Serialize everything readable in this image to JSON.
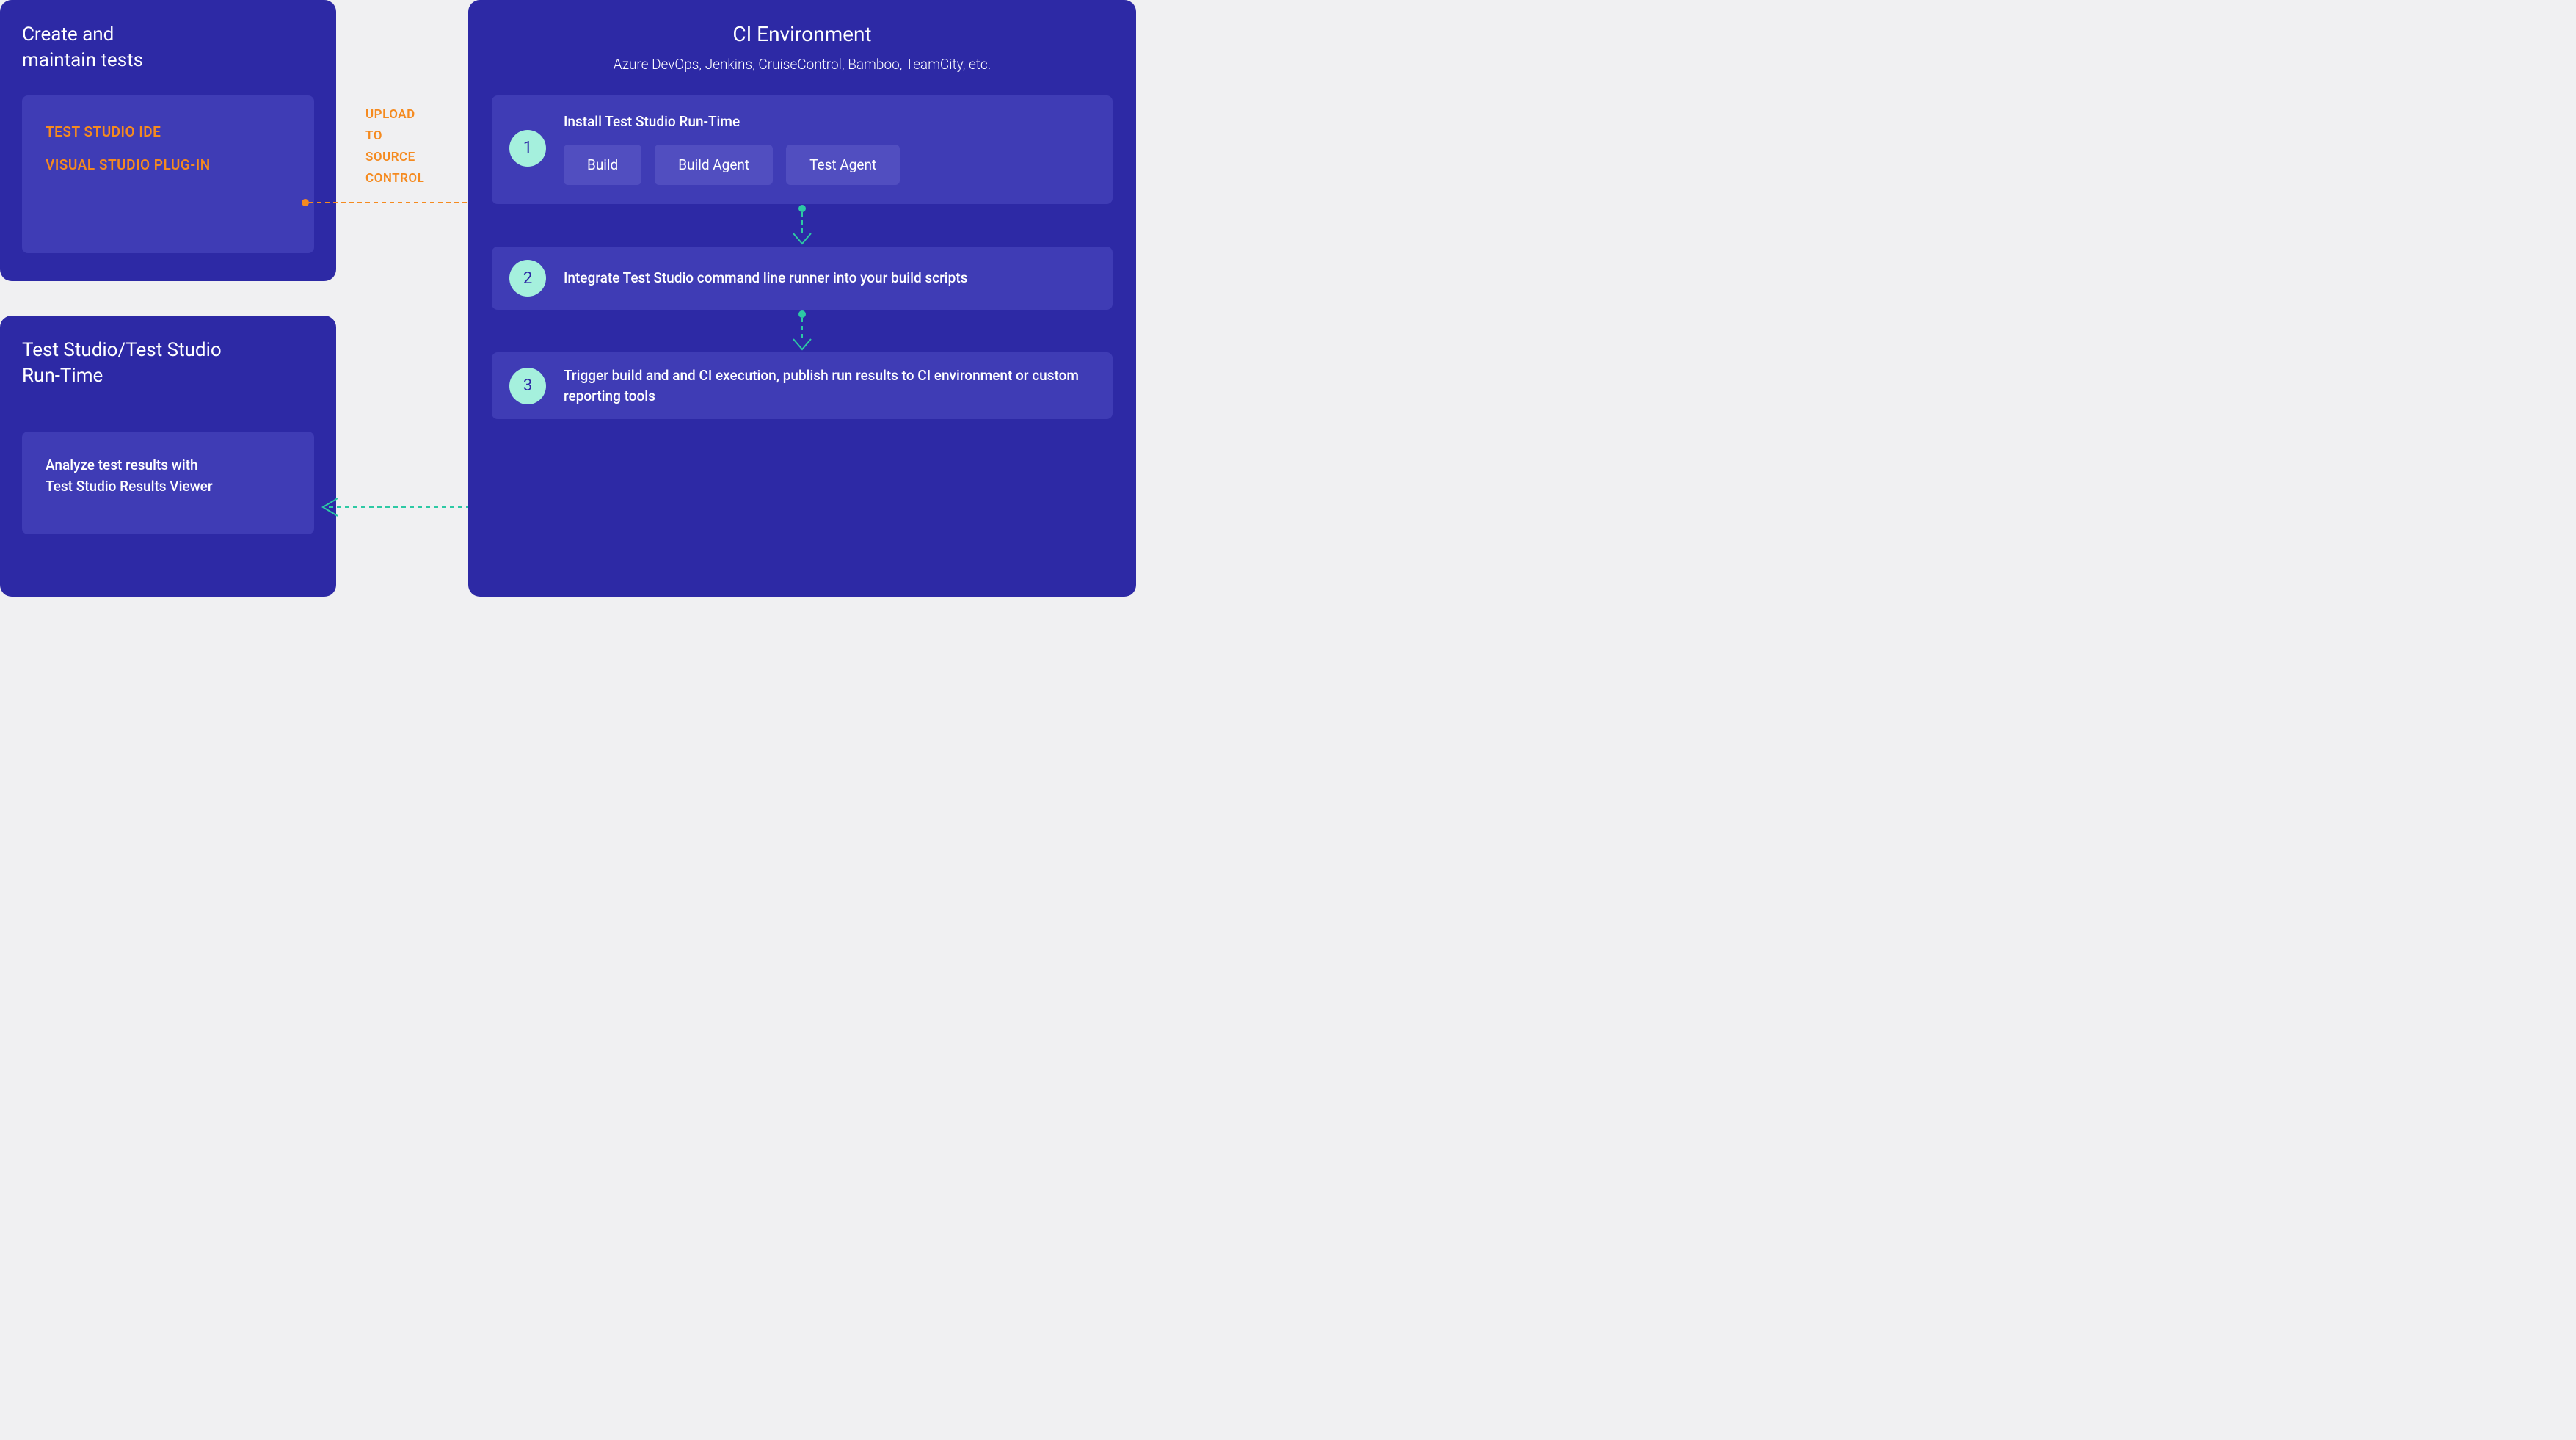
{
  "left_top": {
    "title": "Create and\nmaintain tests",
    "items": [
      "TEST STUDIO IDE",
      "VISUAL STUDIO PLUG-IN"
    ]
  },
  "left_bottom": {
    "title": "Test Studio/Test Studio\nRun-Time",
    "analyze": "Analyze test results with\nTest Studio Results Viewer"
  },
  "center": {
    "upload_label": "UPLOAD\nTO\nSOURCE\nCONTROL"
  },
  "ci": {
    "title": "CI Environment",
    "subtitle": "Azure DevOps, Jenkins, CruiseControl, Bamboo, TeamCity, etc.",
    "steps": [
      {
        "num": "1",
        "title": "Install Test Studio Run-Time",
        "chips": [
          "Build",
          "Build Agent",
          "Test Agent"
        ]
      },
      {
        "num": "2",
        "title": "Integrate Test Studio command line runner into your build scripts"
      },
      {
        "num": "3",
        "title": "Trigger build and and CI execution, publish run results to CI environment or custom reporting tools"
      }
    ]
  }
}
